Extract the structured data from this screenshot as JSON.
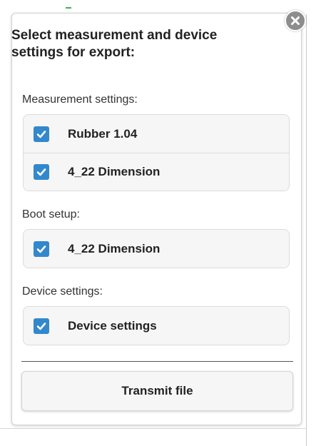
{
  "dialog": {
    "title_line1": "Select measurement and device",
    "title_line2": "settings for export:",
    "close_icon": "close-icon"
  },
  "sections": {
    "measurement": {
      "label": "Measurement settings:",
      "items": [
        {
          "label": "Rubber 1.04",
          "checked": true
        },
        {
          "label": "4_22 Dimension",
          "checked": true
        }
      ]
    },
    "boot": {
      "label": "Boot setup:",
      "items": [
        {
          "label": "4_22 Dimension",
          "checked": true
        }
      ]
    },
    "device": {
      "label": "Device settings:",
      "items": [
        {
          "label": "Device settings",
          "checked": true
        }
      ]
    }
  },
  "actions": {
    "transmit_label": "Transmit file"
  },
  "colors": {
    "checkbox": "#3388cc",
    "close_button": "#8d8d8d"
  }
}
